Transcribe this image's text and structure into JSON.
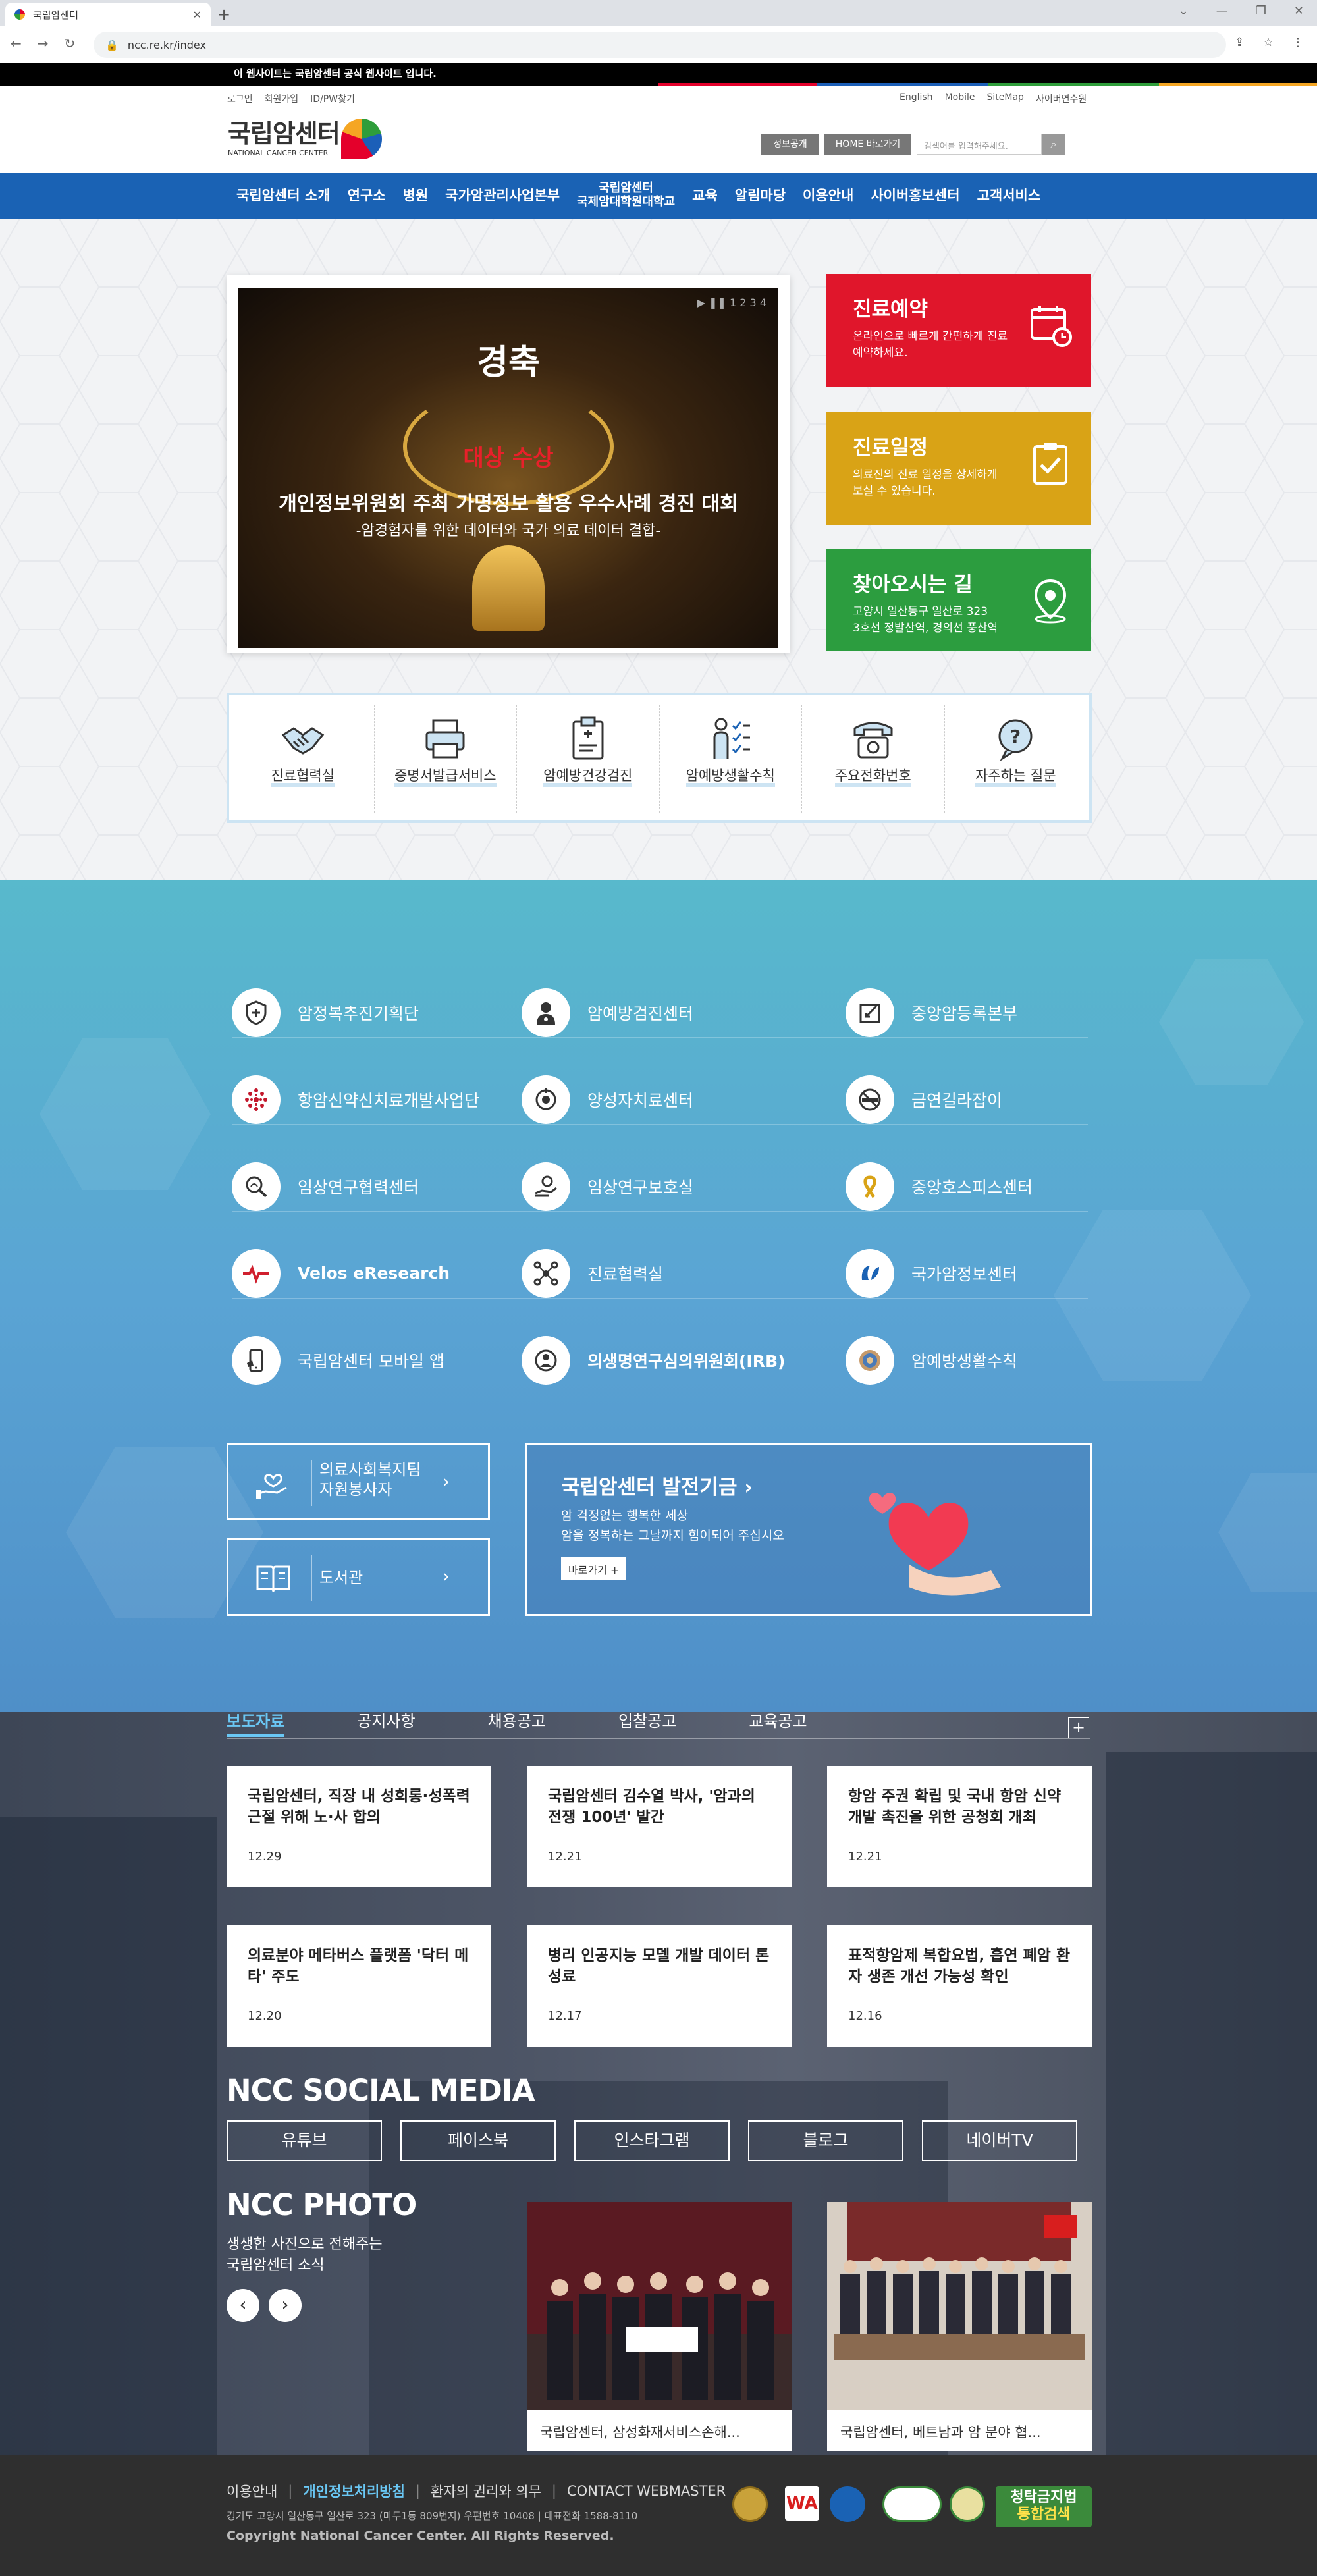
{
  "browser": {
    "tab_title": "국립암센터",
    "url": "ncc.re.kr/index"
  },
  "notice": {
    "text": "이 웹사이트는 국립암센터 공식 웹사이트 입니다."
  },
  "util_left": [
    "로그인",
    "회원가입",
    "ID/PW찾기"
  ],
  "util_right": [
    "English",
    "Mobile",
    "SiteMap",
    "사이버연수원"
  ],
  "logo": {
    "name": "국립암센터",
    "sub": "NATIONAL CANCER CENTER"
  },
  "header": {
    "btn_info": "정보공개",
    "btn_home": "HOME 바로가기",
    "search_placeholder": "검색어를 입력해주세요."
  },
  "gnb": [
    {
      "label": "국립암센터 소개"
    },
    {
      "label": "연구소"
    },
    {
      "label": "병원"
    },
    {
      "label": "국가암관리사업본부"
    },
    {
      "label": "국립암센터\n국제암대학원대학교"
    },
    {
      "label": "교육"
    },
    {
      "label": "알림마당"
    },
    {
      "label": "이용안내"
    },
    {
      "label": "사이버홍보센터"
    },
    {
      "label": "고객서비스"
    }
  ],
  "slide": {
    "title": "경축",
    "award": "대상 수상",
    "line1": "개인정보위원회 주최 가명정보 활용 우수사례 경진 대회",
    "line2": "-암경험자를 위한 데이터와 국가 의료 데이터 결합-",
    "pager": "▶ ❚❚ 1 2 3 4"
  },
  "quick_cards": [
    {
      "title": "진료예약",
      "desc": "온라인으로 빠르게 간편하게 진료 예약하세요.",
      "icon": "calendar-icon",
      "color": "#e0162b"
    },
    {
      "title": "진료일정",
      "desc": "의료진의 진료 일정을 상세하게 보실 수 있습니다.",
      "icon": "clipboard-check-icon",
      "color": "#d9a316"
    },
    {
      "title": "찾아오시는 길",
      "desc": "고양시 일산동구 일산로 323\n3호선 정발산역, 경의선 풍산역",
      "icon": "location-pin-icon",
      "color": "#2c9d3f"
    }
  ],
  "services": [
    {
      "label": "진료협력실",
      "icon": "handshake-icon"
    },
    {
      "label": "증명서발급서비스",
      "icon": "printer-icon"
    },
    {
      "label": "암예방건강검진",
      "icon": "medical-clipboard-icon"
    },
    {
      "label": "암예방생활수칙",
      "icon": "person-checklist-icon"
    },
    {
      "label": "주요전화번호",
      "icon": "telephone-icon"
    },
    {
      "label": "자주하는 질문",
      "icon": "question-bubble-icon"
    }
  ],
  "centers": [
    {
      "label": "암정복추진기획단",
      "icon": "shield-cross-icon"
    },
    {
      "label": "암예방검진센터",
      "icon": "doctor-icon"
    },
    {
      "label": "중앙암등록본부",
      "icon": "register-box-icon"
    },
    {
      "label": "항암신약신치료개발사업단",
      "icon": "molecule-dots-icon"
    },
    {
      "label": "양성자치료센터",
      "icon": "proton-target-icon"
    },
    {
      "label": "금연길라잡이",
      "icon": "no-smoking-icon"
    },
    {
      "label": "임상연구협력센터",
      "icon": "magnifier-lab-icon"
    },
    {
      "label": "임상연구보호실",
      "icon": "hand-protect-icon"
    },
    {
      "label": "중앙호스피스센터",
      "icon": "ribbon-icon"
    },
    {
      "label": "Velos eResearch",
      "icon": "velos-logo-icon"
    },
    {
      "label": "진료협력실",
      "icon": "network-nodes-icon"
    },
    {
      "label": "국가암정보센터",
      "icon": "cancer-info-logo-icon"
    },
    {
      "label": "국립암센터 모바일 앱",
      "icon": "mobile-app-icon"
    },
    {
      "label": "의생명연구심의위원회(IRB)",
      "icon": "irb-person-icon"
    },
    {
      "label": "암예방생활수칙",
      "icon": "prevention-seal-icon"
    }
  ],
  "volunteer": {
    "label": "의료사회복지팀\n자원봉사자",
    "icon": "hand-heart-icon"
  },
  "library": {
    "label": "도서관",
    "icon": "book-icon"
  },
  "fund": {
    "title": "국립암센터 발전기금",
    "desc1": "암 걱정없는 행복한 세상",
    "desc2": "암을 정복하는 그날까지 힘이되어 주십시오",
    "button": "바로가기 +"
  },
  "news_tabs": [
    "보도자료",
    "공지사항",
    "채용공고",
    "입찰공고",
    "교육공고"
  ],
  "news": [
    {
      "title": "국립암센터, 직장 내 성희롱·성폭력 근절 위해 노·사 합의",
      "date": "12.29"
    },
    {
      "title": "국립암센터 김수열 박사, '암과의 전쟁 100년' 발간",
      "date": "12.21"
    },
    {
      "title": "항암 주권 확립 및 국내 항암 신약 개발 촉진을 위한 공청회 개최",
      "date": "12.21"
    },
    {
      "title": "의료분야 메타버스 플랫폼 '닥터 메타' 주도",
      "date": "12.20"
    },
    {
      "title": "병리 인공지능 모델 개발 데이터 톤 성료",
      "date": "12.17"
    },
    {
      "title": "표적항암제 복합요법, 흡연 폐암 환자 생존 개선 가능성 확인",
      "date": "12.16"
    }
  ],
  "social": {
    "title": "NCC SOCIAL MEDIA",
    "buttons": [
      "유튜브",
      "페이스북",
      "인스타그램",
      "블로그",
      "네이버TV"
    ]
  },
  "photo": {
    "title": "NCC PHOTO",
    "desc1": "생생한 사진으로 전해주는",
    "desc2": "국립암센터 소식",
    "items": [
      {
        "caption": "국립암센터, 삼성화재서비스손해..."
      },
      {
        "caption": "국립암센터, 베트남과 암 분야 협..."
      }
    ]
  },
  "footer": {
    "links": [
      "이용안내",
      "개인정보처리방침",
      "환자의 권리와 의무",
      "CONTACT WEBMASTER"
    ],
    "address": "경기도 고양시 일산동구 일산로 323 (마두1동 809번지) 우편번호 10408  |  대표전화 1588-8110",
    "copyright": "Copyright National Cancer Center. All Rights Reserved.",
    "tag_line1": "청탁금지법",
    "tag_line2": "통합검색"
  }
}
